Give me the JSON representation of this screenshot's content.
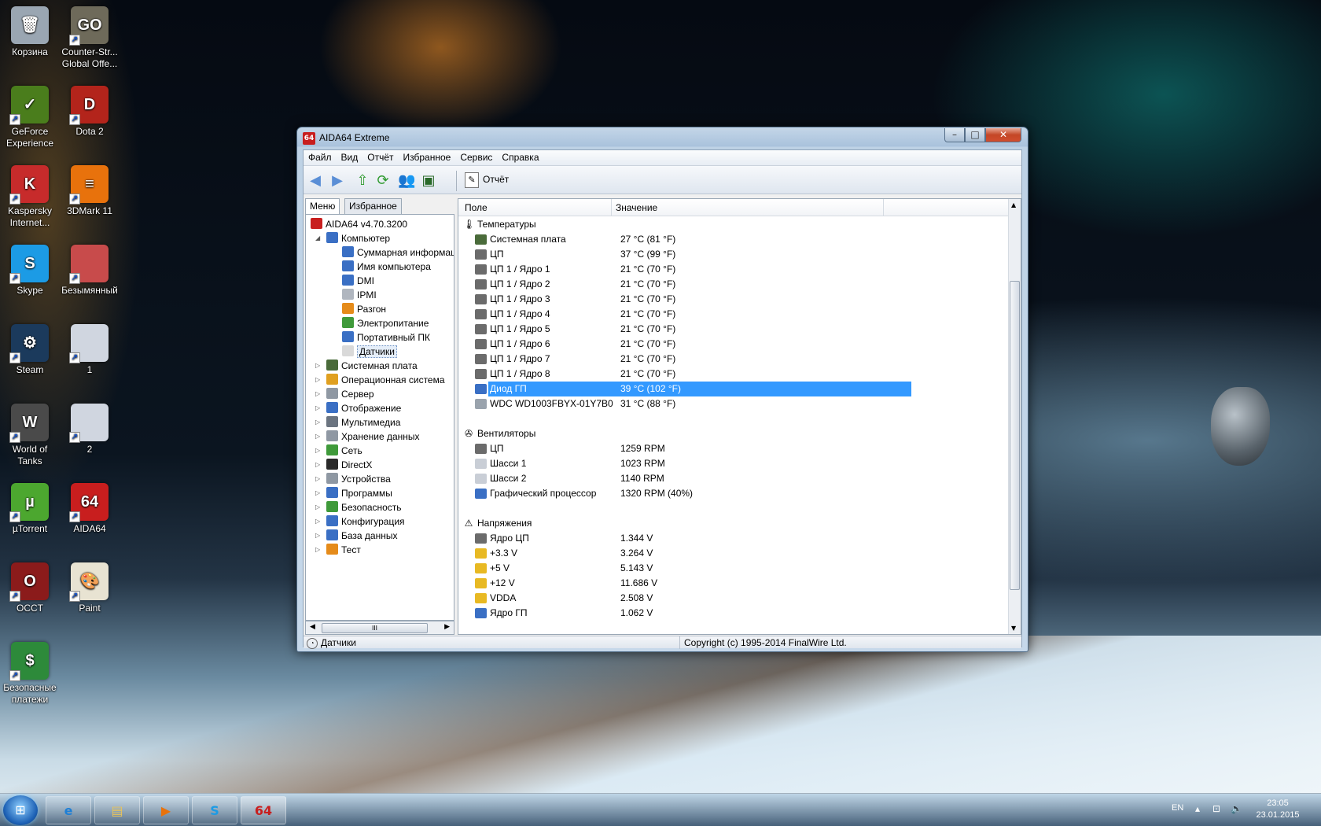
{
  "desktop": {
    "icons": [
      {
        "label": "Корзина",
        "icon": "recycle-bin-icon",
        "color": "#9aa6b2",
        "glyph": "🗑"
      },
      {
        "label": "Counter-Str... Global Offe...",
        "icon": "csgo-icon",
        "color": "#6e6a5a",
        "glyph": "GO"
      },
      {
        "label": "GeForce Experience",
        "icon": "geforce-icon",
        "color": "#4a7d1c",
        "glyph": "✓"
      },
      {
        "label": "Dota 2",
        "icon": "dota2-icon",
        "color": "#b3241b",
        "glyph": "D"
      },
      {
        "label": "Kaspersky Internet...",
        "icon": "kaspersky-icon",
        "color": "#c72b2b",
        "glyph": "K"
      },
      {
        "label": "3DMark 11",
        "icon": "3dmark-icon",
        "color": "#e8720c",
        "glyph": "≡"
      },
      {
        "label": "Skype",
        "icon": "skype-icon",
        "color": "#1c9be5",
        "glyph": "S"
      },
      {
        "label": "Безымянный",
        "icon": "image-file-icon",
        "color": "#c84b4b",
        "glyph": ""
      },
      {
        "label": "Steam",
        "icon": "steam-icon",
        "color": "#1b3a5c",
        "glyph": "⚙"
      },
      {
        "label": "1",
        "icon": "image-file-icon",
        "color": "#d0d6e0",
        "glyph": ""
      },
      {
        "label": "World of Tanks",
        "icon": "wot-icon",
        "color": "#4a4a4a",
        "glyph": "W"
      },
      {
        "label": "2",
        "icon": "image-file-icon",
        "color": "#d0d6e0",
        "glyph": ""
      },
      {
        "label": "µTorrent",
        "icon": "utorrent-icon",
        "color": "#4ca72f",
        "glyph": "µ"
      },
      {
        "label": "AIDA64",
        "icon": "aida64-icon",
        "color": "#c81e1e",
        "glyph": "64"
      },
      {
        "label": "OCCT",
        "icon": "occt-icon",
        "color": "#8b1b1b",
        "glyph": "O"
      },
      {
        "label": "Paint",
        "icon": "paint-icon",
        "color": "#e8e3d2",
        "glyph": "🎨"
      },
      {
        "label": "Безопасные платежи",
        "icon": "safe-money-icon",
        "color": "#2d8a3a",
        "glyph": "$"
      }
    ]
  },
  "window": {
    "title": "AIDA64 Extreme",
    "app_icon_text": "64",
    "controls": {
      "minimize": "–",
      "maximize": "□",
      "close": "✕"
    }
  },
  "menu": [
    "Файл",
    "Вид",
    "Отчёт",
    "Избранное",
    "Сервис",
    "Справка"
  ],
  "toolbar": {
    "report_label": "Отчёт"
  },
  "left_tabs": [
    "Меню",
    "Избранное"
  ],
  "tree": [
    {
      "label": "AIDA64 v4.70.3200",
      "level": 0,
      "exp": "",
      "color": "#c81e1e"
    },
    {
      "label": "Компьютер",
      "level": 1,
      "exp": "◢",
      "color": "#3a6fc4"
    },
    {
      "label": "Суммарная информация",
      "level": 2,
      "exp": "",
      "color": "#3a6fc4"
    },
    {
      "label": "Имя компьютера",
      "level": 2,
      "exp": "",
      "color": "#3a6fc4"
    },
    {
      "label": "DMI",
      "level": 2,
      "exp": "",
      "color": "#3a6fc4"
    },
    {
      "label": "IPMI",
      "level": 2,
      "exp": "",
      "color": "#b0b6bf"
    },
    {
      "label": "Разгон",
      "level": 2,
      "exp": "",
      "color": "#e58b1a"
    },
    {
      "label": "Электропитание",
      "level": 2,
      "exp": "",
      "color": "#3f9a3a"
    },
    {
      "label": "Портативный ПК",
      "level": 2,
      "exp": "",
      "color": "#3a6fc4"
    },
    {
      "label": "Датчики",
      "level": 2,
      "exp": "",
      "color": "#d9d9d9",
      "selected": true
    },
    {
      "label": "Системная плата",
      "level": 1,
      "exp": "▷",
      "color": "#4a6b3a"
    },
    {
      "label": "Операционная система",
      "level": 1,
      "exp": "▷",
      "color": "#e0a020"
    },
    {
      "label": "Сервер",
      "level": 1,
      "exp": "▷",
      "color": "#8f98a3"
    },
    {
      "label": "Отображение",
      "level": 1,
      "exp": "▷",
      "color": "#3a6fc4"
    },
    {
      "label": "Мультимедиа",
      "level": 1,
      "exp": "▷",
      "color": "#6b7480"
    },
    {
      "label": "Хранение данных",
      "level": 1,
      "exp": "▷",
      "color": "#8f98a3"
    },
    {
      "label": "Сеть",
      "level": 1,
      "exp": "▷",
      "color": "#3f9a3a"
    },
    {
      "label": "DirectX",
      "level": 1,
      "exp": "▷",
      "color": "#2a2a2a"
    },
    {
      "label": "Устройства",
      "level": 1,
      "exp": "▷",
      "color": "#8f98a3"
    },
    {
      "label": "Программы",
      "level": 1,
      "exp": "▷",
      "color": "#3a6fc4"
    },
    {
      "label": "Безопасность",
      "level": 1,
      "exp": "▷",
      "color": "#3f9a3a"
    },
    {
      "label": "Конфигурация",
      "level": 1,
      "exp": "▷",
      "color": "#3a6fc4"
    },
    {
      "label": "База данных",
      "level": 1,
      "exp": "▷",
      "color": "#3a6fc4"
    },
    {
      "label": "Тест",
      "level": 1,
      "exp": "▷",
      "color": "#e58b1a"
    }
  ],
  "columns": {
    "field": "Поле",
    "value": "Значение"
  },
  "sensor_groups": [
    {
      "title": "Температуры",
      "icon": "thermometer-icon",
      "glyph": "🌡",
      "rows": [
        {
          "field": "Системная плата",
          "value": "27 °C  (81 °F)",
          "color": "#4a6b3a"
        },
        {
          "field": "ЦП",
          "value": "37 °C  (99 °F)",
          "color": "#6b6b6b"
        },
        {
          "field": "ЦП 1 / Ядро 1",
          "value": "21 °C  (70 °F)",
          "color": "#6b6b6b"
        },
        {
          "field": "ЦП 1 / Ядро 2",
          "value": "21 °C  (70 °F)",
          "color": "#6b6b6b"
        },
        {
          "field": "ЦП 1 / Ядро 3",
          "value": "21 °C  (70 °F)",
          "color": "#6b6b6b"
        },
        {
          "field": "ЦП 1 / Ядро 4",
          "value": "21 °C  (70 °F)",
          "color": "#6b6b6b"
        },
        {
          "field": "ЦП 1 / Ядро 5",
          "value": "21 °C  (70 °F)",
          "color": "#6b6b6b"
        },
        {
          "field": "ЦП 1 / Ядро 6",
          "value": "21 °C  (70 °F)",
          "color": "#6b6b6b"
        },
        {
          "field": "ЦП 1 / Ядро 7",
          "value": "21 °C  (70 °F)",
          "color": "#6b6b6b"
        },
        {
          "field": "ЦП 1 / Ядро 8",
          "value": "21 °C  (70 °F)",
          "color": "#6b6b6b"
        },
        {
          "field": "Диод ГП",
          "value": "39 °C  (102 °F)",
          "color": "#3a6fc4",
          "selected": true
        },
        {
          "field": "WDC WD1003FBYX-01Y7B0",
          "value": "31 °C  (88 °F)",
          "color": "#9aa3ad"
        }
      ]
    },
    {
      "title": "Вентиляторы",
      "icon": "fan-icon",
      "glyph": "✇",
      "rows": [
        {
          "field": "ЦП",
          "value": "1259 RPM",
          "color": "#6b6b6b"
        },
        {
          "field": "Шасси 1",
          "value": "1023 RPM",
          "color": "#c9ced6"
        },
        {
          "field": "Шасси 2",
          "value": "1140 RPM",
          "color": "#c9ced6"
        },
        {
          "field": "Графический процессор",
          "value": "1320 RPM  (40%)",
          "color": "#3a6fc4"
        }
      ]
    },
    {
      "title": "Напряжения",
      "icon": "warning-icon",
      "glyph": "⚠",
      "rows": [
        {
          "field": "Ядро ЦП",
          "value": "1.344 V",
          "color": "#6b6b6b"
        },
        {
          "field": "+3.3 V",
          "value": "3.264 V",
          "color": "#e8b923"
        },
        {
          "field": "+5 V",
          "value": "5.143 V",
          "color": "#e8b923"
        },
        {
          "field": "+12 V",
          "value": "11.686 V",
          "color": "#e8b923"
        },
        {
          "field": "VDDA",
          "value": "2.508 V",
          "color": "#e8b923"
        },
        {
          "field": "Ядро ГП",
          "value": "1.062 V",
          "color": "#3a6fc4"
        }
      ]
    }
  ],
  "statusbar": {
    "left": "Датчики",
    "right": "Copyright (c) 1995-2014 FinalWire Ltd."
  },
  "taskbar": {
    "start_label": "⊞",
    "buttons": [
      {
        "name": "ie",
        "glyph": "e",
        "color": "#1e7fd6"
      },
      {
        "name": "explorer",
        "glyph": "▤",
        "color": "#e8c35a"
      },
      {
        "name": "media-player",
        "glyph": "▶",
        "color": "#e8720c"
      },
      {
        "name": "skype",
        "glyph": "S",
        "color": "#1c9be5"
      },
      {
        "name": "aida64",
        "glyph": "64",
        "color": "#c81e1e"
      }
    ],
    "language": "EN",
    "time": "23:05",
    "date": "23.01.2015"
  }
}
